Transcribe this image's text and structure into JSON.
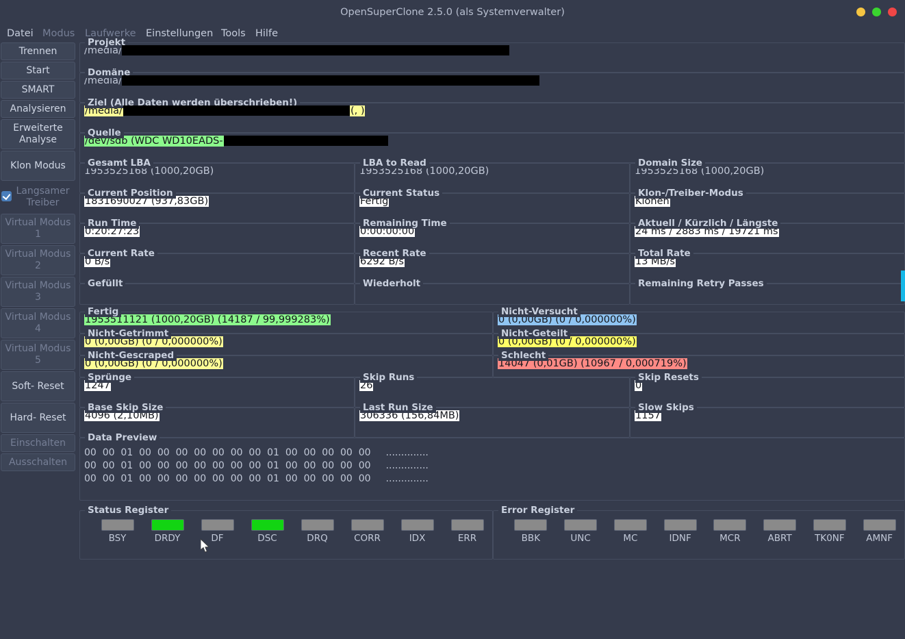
{
  "window": {
    "title": "OpenSuperClone 2.5.0 (als Systemverwalter)",
    "controls": {
      "minimize": "minimize-dot",
      "maximize": "maximize-dot",
      "close": "close-dot"
    },
    "colors": {
      "minimize": "#f5c542",
      "maximize": "#3ad42f",
      "close": "#f04646",
      "background": "#353b4c",
      "accent": "#16b8e8"
    }
  },
  "menubar": {
    "items": [
      {
        "label": "Datei",
        "enabled": true
      },
      {
        "label": "Modus",
        "enabled": false
      },
      {
        "label": "Laufwerke",
        "enabled": false
      },
      {
        "label": "Einstellungen",
        "enabled": true
      },
      {
        "label": "Tools",
        "enabled": true
      },
      {
        "label": "Hilfe",
        "enabled": true
      }
    ]
  },
  "sidebar": {
    "items": [
      {
        "label": "Trennen",
        "enabled": true,
        "lines": 1
      },
      {
        "label": "Start",
        "enabled": true,
        "lines": 1
      },
      {
        "label": "SMART",
        "enabled": true,
        "lines": 1
      },
      {
        "label": "Analysieren",
        "enabled": true,
        "lines": 1
      },
      {
        "label": "Erweiterte Analyse",
        "enabled": true,
        "lines": 2
      },
      {
        "label": "Klon Modus",
        "enabled": true,
        "lines": 2
      },
      {
        "label": "Langsamer Treiber",
        "enabled": false,
        "lines": 2,
        "checkbox": true,
        "checked": true
      },
      {
        "label": "Virtual Modus 1",
        "enabled": false,
        "lines": 2
      },
      {
        "label": "Virtual Modus 2",
        "enabled": false,
        "lines": 2
      },
      {
        "label": "Virtual Modus 3",
        "enabled": false,
        "lines": 2
      },
      {
        "label": "Virtual Modus 4",
        "enabled": false,
        "lines": 2
      },
      {
        "label": "Virtual Modus 5",
        "enabled": false,
        "lines": 2
      },
      {
        "label": "Soft- Reset",
        "enabled": true,
        "lines": 2
      },
      {
        "label": "Hard- Reset",
        "enabled": true,
        "lines": 2
      },
      {
        "label": "Einschalten",
        "enabled": false,
        "lines": 1
      },
      {
        "label": "Ausschalten",
        "enabled": false,
        "lines": 1
      }
    ]
  },
  "paths": {
    "projekt": {
      "label": "Projekt",
      "prefix": "/media/",
      "redacted": true
    },
    "domaene": {
      "label": "Domäne",
      "prefix": "/media/",
      "redacted": true
    },
    "ziel": {
      "label": "Ziel (Alle Daten werden überschrieben!)",
      "prefix": "/media/",
      "suffix": "(, )",
      "redacted": true
    },
    "quelle": {
      "label": "Quelle",
      "prefix": "/dev/sdb (WDC WD10EADS-",
      "redacted": true
    }
  },
  "stats": {
    "gesamt_lba": {
      "label": "Gesamt LBA",
      "value": "1953525168 (1000,20GB)",
      "highlight": "none"
    },
    "lba_to_read": {
      "label": "LBA to Read",
      "value": "1953525168 (1000,20GB)",
      "highlight": "none"
    },
    "domain_size": {
      "label": "Domain Size",
      "value": "1953525168 (1000,20GB)",
      "highlight": "none"
    },
    "current_position": {
      "label": "Current Position",
      "value": "1831690027 (937,83GB)",
      "highlight": "white"
    },
    "current_status": {
      "label": "Current Status",
      "value": "Fertig",
      "highlight": "white"
    },
    "klon_treiber_modus": {
      "label": "Klon-/Treiber-Modus",
      "value": "Klonen",
      "highlight": "white"
    },
    "run_time": {
      "label": "Run Time",
      "value": "0:20:27:23",
      "highlight": "white"
    },
    "remaining_time": {
      "label": "Remaining Time",
      "value": "0:00:00:00",
      "highlight": "white"
    },
    "aktuell_kuerzlich_laengste": {
      "label": "Aktuell / Kürzlich / Längste",
      "value": "24 ms / 2883 ms / 19721 ms",
      "highlight": "white"
    },
    "current_rate": {
      "label": "Current Rate",
      "value": "0 B/s",
      "highlight": "white"
    },
    "recent_rate": {
      "label": "Recent Rate",
      "value": "6292 B/s",
      "highlight": "white"
    },
    "total_rate": {
      "label": "Total Rate",
      "value": "13 MB/s",
      "highlight": "white"
    },
    "gefuellt": {
      "label": "Gefüllt",
      "value": "",
      "highlight": "none"
    },
    "wiederholt": {
      "label": "Wiederholt",
      "value": "",
      "highlight": "none"
    },
    "remaining_retry_passes": {
      "label": "Remaining Retry Passes",
      "value": "",
      "highlight": "none"
    }
  },
  "results": {
    "fertig": {
      "label": "Fertig",
      "value": "1953511121 (1000,20GB) (14187 / 99,999283%)",
      "highlight": "green"
    },
    "nicht_versucht": {
      "label": "Nicht-Versucht",
      "value": "0 (0,00GB) (0 / 0,000000%)",
      "highlight": "blue"
    },
    "nicht_getrimmt": {
      "label": "Nicht-Getrimmt",
      "value": "0 (0,00GB) (0 / 0,000000%)",
      "highlight": "yellow"
    },
    "nicht_geteilt": {
      "label": "Nicht-Geteilt",
      "value": "0 (0,00GB) (0 / 0,000000%)",
      "highlight": "yellow2"
    },
    "nicht_gescraped": {
      "label": "Nicht-Gescraped",
      "value": "0 (0,00GB) (0 / 0,000000%)",
      "highlight": "yellow"
    },
    "schlecht": {
      "label": "Schlecht",
      "value": "14047 (0,01GB) (10967 / 0,000719%)",
      "highlight": "red"
    }
  },
  "skips": {
    "spruenge": {
      "label": "Sprünge",
      "value": "1247",
      "highlight": "white"
    },
    "skip_runs": {
      "label": "Skip Runs",
      "value": "26",
      "highlight": "white"
    },
    "skip_resets": {
      "label": "Skip Resets",
      "value": "0",
      "highlight": "white"
    },
    "base_skip_size": {
      "label": "Base Skip Size",
      "value": "4096 (2,10MB)",
      "highlight": "white"
    },
    "last_run_size": {
      "label": "Last Run Size",
      "value": "306336 (156,84MB)",
      "highlight": "white"
    },
    "slow_skips": {
      "label": "Slow Skips",
      "value": "1157",
      "highlight": "white"
    }
  },
  "data_preview": {
    "label": "Data Preview",
    "lines": [
      {
        "hex": "00  00  01  00  00  00  00  00  00  00  01  00  00  00  00  00",
        "ascii": ".............."
      },
      {
        "hex": "00  00  01  00  00  00  00  00  00  00  01  00  00  00  00  00",
        "ascii": ".............."
      },
      {
        "hex": "00  00  01  00  00  00  00  00  00  00  01  00  00  00  00  00",
        "ascii": ".............."
      }
    ]
  },
  "status_register": {
    "label": "Status Register",
    "leds": [
      {
        "name": "BSY",
        "on": false
      },
      {
        "name": "DRDY",
        "on": true
      },
      {
        "name": "DF",
        "on": false
      },
      {
        "name": "DSC",
        "on": true
      },
      {
        "name": "DRQ",
        "on": false
      },
      {
        "name": "CORR",
        "on": false
      },
      {
        "name": "IDX",
        "on": false
      },
      {
        "name": "ERR",
        "on": false
      }
    ]
  },
  "error_register": {
    "label": "Error Register",
    "leds": [
      {
        "name": "BBK",
        "on": false
      },
      {
        "name": "UNC",
        "on": false
      },
      {
        "name": "MC",
        "on": false
      },
      {
        "name": "IDNF",
        "on": false
      },
      {
        "name": "MCR",
        "on": false
      },
      {
        "name": "ABRT",
        "on": false
      },
      {
        "name": "TK0NF",
        "on": false
      },
      {
        "name": "AMNF",
        "on": false
      }
    ]
  }
}
